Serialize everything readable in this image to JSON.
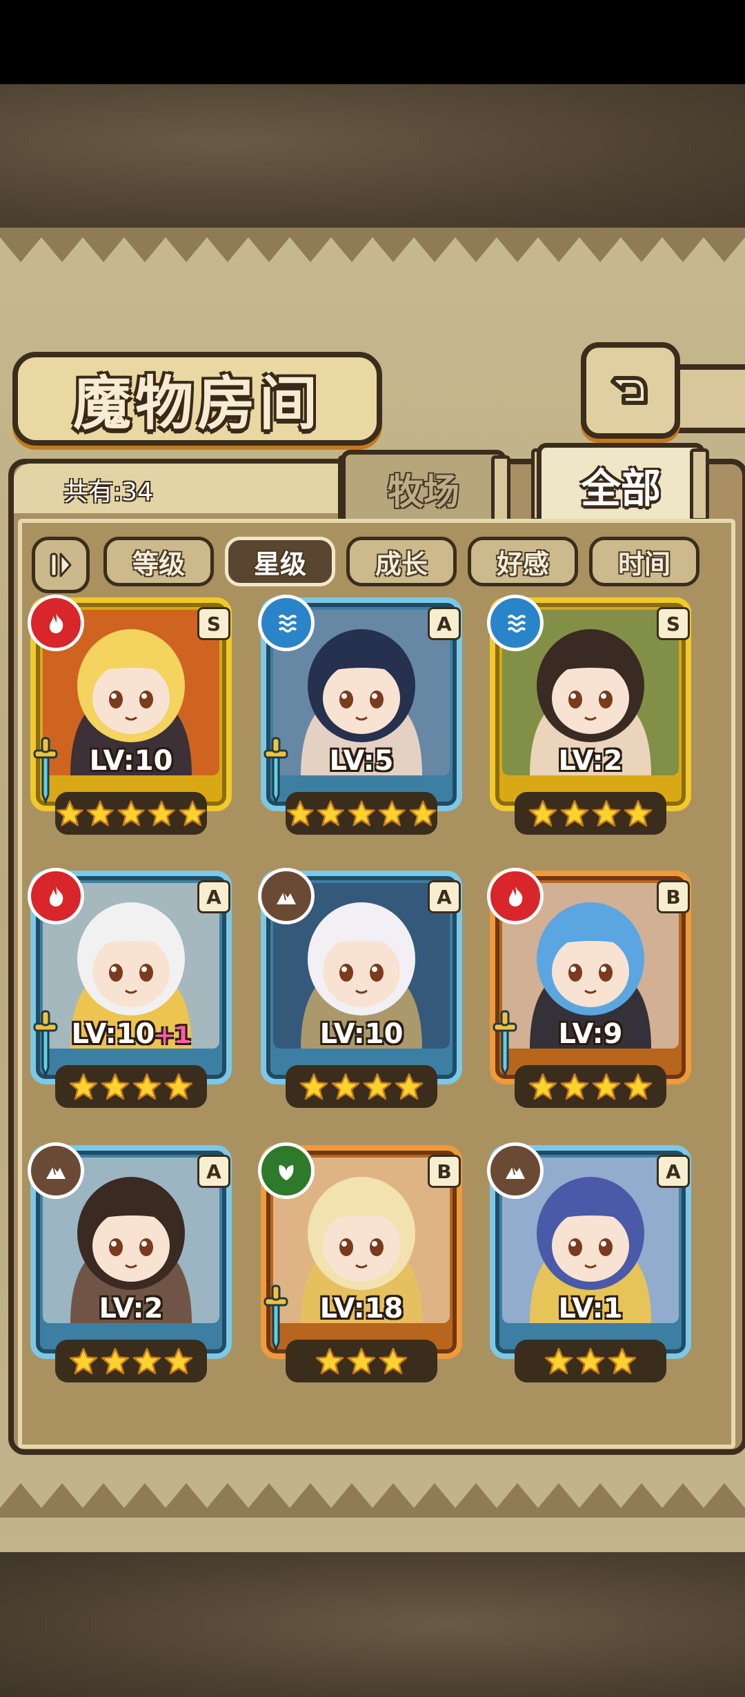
{
  "title": "魔物房间",
  "count_label": "共有:34",
  "tabs": [
    {
      "label": "牧场",
      "selected": false
    },
    {
      "label": "全部",
      "selected": true
    }
  ],
  "sort_buttons": [
    {
      "label": "等级",
      "active": false
    },
    {
      "label": "星级",
      "active": true
    },
    {
      "label": "成长",
      "active": false
    },
    {
      "label": "好感",
      "active": false
    },
    {
      "label": "时间",
      "active": false
    }
  ],
  "monsters": [
    {
      "rank": "S",
      "frame": "gold",
      "element": "fire",
      "level": "LV:10",
      "bonus": "",
      "stars": 5,
      "has_weapon": true,
      "palette": [
        "#f4d35e",
        "#2b2b3a",
        "#c92b2b"
      ]
    },
    {
      "rank": "A",
      "frame": "blue",
      "element": "water",
      "level": "LV:5",
      "bonus": "",
      "stars": 5,
      "has_weapon": true,
      "palette": [
        "#26304f",
        "#f3d9c6",
        "#8a8fa8"
      ]
    },
    {
      "rank": "S",
      "frame": "gold",
      "element": "water",
      "level": "LV:2",
      "bonus": "",
      "stars": 4,
      "has_weapon": false,
      "palette": [
        "#3a2a24",
        "#f5dcc8",
        "#3b7c6f"
      ]
    },
    {
      "rank": "A",
      "frame": "blue",
      "element": "fire",
      "level": "LV:10",
      "bonus": "+1",
      "stars": 4,
      "has_weapon": true,
      "palette": [
        "#f1f1f1",
        "#f4c542",
        "#fbe7d4"
      ]
    },
    {
      "rank": "A",
      "frame": "blue",
      "element": "earth",
      "level": "LV:10",
      "bonus": "",
      "stars": 4,
      "has_weapon": false,
      "palette": [
        "#f2f0f4",
        "#b8a06a",
        "#2f3b5a"
      ]
    },
    {
      "rank": "B",
      "frame": "orange",
      "element": "fire",
      "level": "LV:9",
      "bonus": "",
      "stars": 4,
      "has_weapon": true,
      "palette": [
        "#5ba6e0",
        "#24242e",
        "#e7eef6"
      ]
    },
    {
      "rank": "A",
      "frame": "blue",
      "element": "earth",
      "level": "LV:2",
      "bonus": "",
      "stars": 4,
      "has_weapon": false,
      "palette": [
        "#3b2a22",
        "#6b4a3a",
        "#e9e4dc"
      ]
    },
    {
      "rank": "B",
      "frame": "orange",
      "element": "nature",
      "level": "LV:18",
      "bonus": "",
      "stars": 3,
      "has_weapon": true,
      "palette": [
        "#f2e2b0",
        "#e7c15a",
        "#fff5d8"
      ]
    },
    {
      "rank": "A",
      "frame": "blue",
      "element": "earth",
      "level": "LV:1",
      "bonus": "",
      "stars": 3,
      "has_weapon": false,
      "palette": [
        "#4a5aa8",
        "#f0c64a",
        "#d9d2f2"
      ]
    }
  ],
  "element_colors": {
    "fire": "#d8262a",
    "water": "#2a84c9",
    "earth": "#6a4a34",
    "nature": "#2e7a2a"
  }
}
